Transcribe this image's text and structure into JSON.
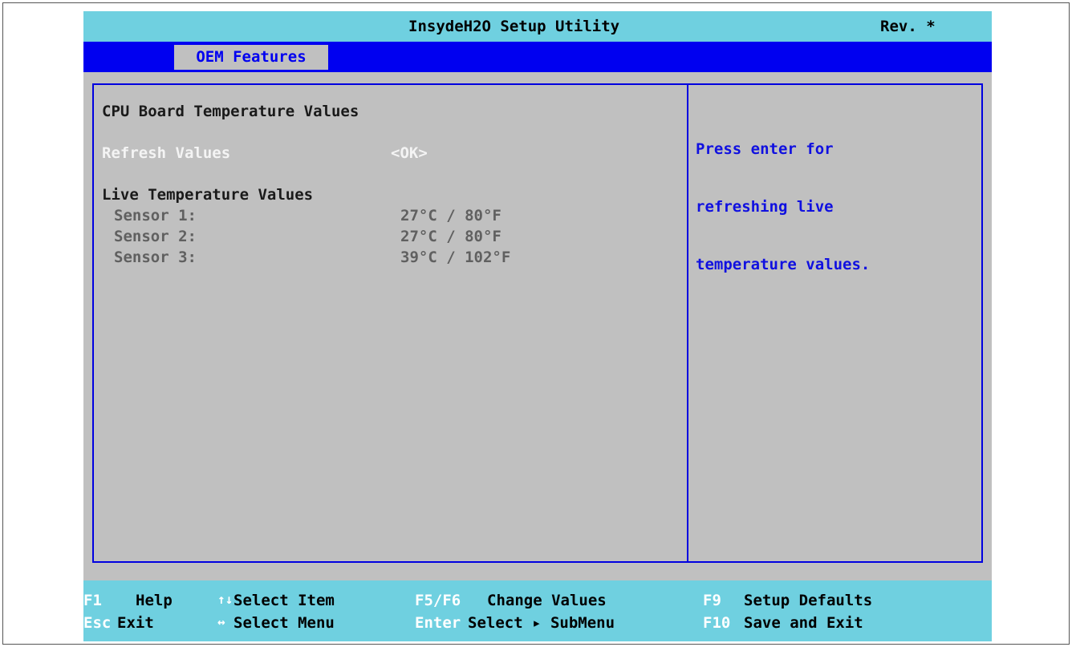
{
  "title": {
    "app_name": "InsydeH2O Setup Utility",
    "revision": "Rev. *"
  },
  "menu": {
    "active_tab": "OEM Features"
  },
  "main": {
    "section_title": "CPU Board Temperature Values",
    "refresh": {
      "label": "Refresh Values",
      "value": "<OK>"
    },
    "live_title": "Live Temperature Values",
    "sensors": [
      {
        "label": "Sensor 1:",
        "value": "27°C / 80°F"
      },
      {
        "label": "Sensor 2:",
        "value": "27°C / 80°F"
      },
      {
        "label": "Sensor 3:",
        "value": "39°C / 102°F"
      }
    ]
  },
  "help_panel": {
    "lines": [
      "Press enter for",
      "refreshing live",
      "temperature values."
    ]
  },
  "footer": {
    "row1": [
      {
        "key": "F1",
        "action": "Help"
      },
      {
        "key": "↑↓",
        "action": "Select Item",
        "key_icon": "up-down-arrow-icon"
      },
      {
        "key": "F5/F6",
        "action": "Change Values"
      },
      {
        "key": "F9",
        "action": "Setup Defaults"
      }
    ],
    "row2": [
      {
        "key": "Esc",
        "action": "Exit"
      },
      {
        "key": "↔",
        "action": "Select Menu",
        "key_icon": "left-right-arrow-icon"
      },
      {
        "key": "Enter",
        "action": "Select ▸ SubMenu"
      },
      {
        "key": "F10",
        "action": "Save and Exit"
      }
    ]
  },
  "colors": {
    "title_bar": "#6fd0e0",
    "menu_bar": "#0000f0",
    "background": "#c0c0c0",
    "help_text": "#1010e0",
    "selected_text": "#f4f4f4"
  }
}
